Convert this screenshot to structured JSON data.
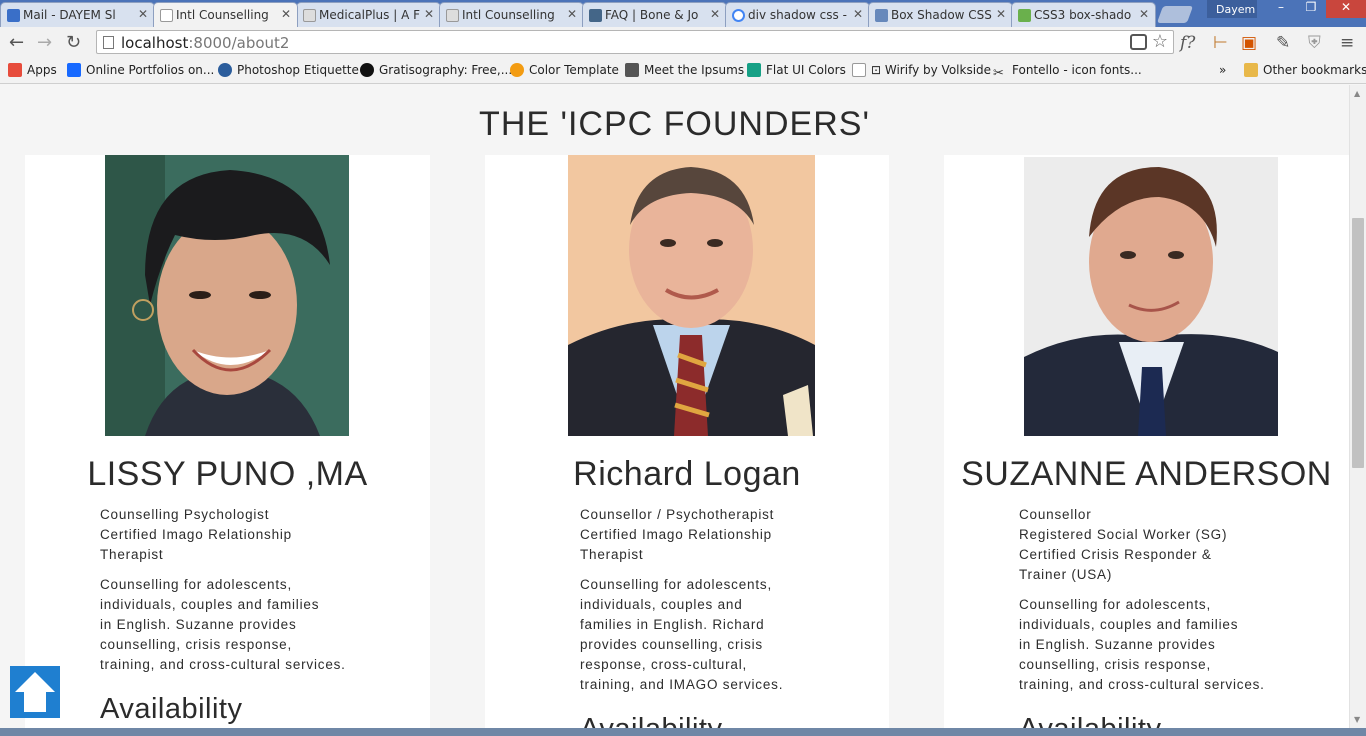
{
  "browser": {
    "tabs": [
      {
        "title": "Mail - DAYEM Sl",
        "favicon_color": "#3a6fc8",
        "active": false
      },
      {
        "title": "Intl Counselling",
        "favicon_color": "#eeeeee",
        "active": true
      },
      {
        "title": "MedicalPlus | A F",
        "favicon_color": "#dddddd",
        "active": false
      },
      {
        "title": "Intl Counselling",
        "favicon_color": "#dddddd",
        "active": false
      },
      {
        "title": "FAQ | Bone & Jo",
        "favicon_color": "#446688",
        "active": false
      },
      {
        "title": "div shadow css -",
        "favicon_color": "#4285f4",
        "active": false
      },
      {
        "title": "Box Shadow CSS",
        "favicon_color": "#6688bb",
        "active": false
      },
      {
        "title": "CSS3 box-shado",
        "favicon_color": "#6ab04c",
        "active": false
      }
    ],
    "user": "Dayem",
    "window_controls": {
      "minimize": "–",
      "maximize": "❐",
      "close": "✕"
    },
    "url_host": "localhost",
    "url_path": ":8000/about2",
    "bookmarks": [
      {
        "label": "Apps",
        "icon": "apps-grid-icon",
        "color": "#e74c3c"
      },
      {
        "label": "Online Portfolios on...",
        "icon": "behance-icon",
        "color": "#1769ff"
      },
      {
        "label": "Photoshop Etiquette",
        "icon": "photoshop-icon",
        "color": "#2b5d9c"
      },
      {
        "label": "Gratisography: Free,...",
        "icon": "gratisography-icon",
        "color": "#111111"
      },
      {
        "label": "Color Template",
        "icon": "color-wheel-icon",
        "color": "#f39c12"
      },
      {
        "label": "Meet the Ipsums",
        "icon": "ipsum-icon",
        "color": "#555555"
      },
      {
        "label": "Flat UI Colors",
        "icon": "flat-ui-icon",
        "color": "#16a085"
      },
      {
        "label": "⊡ Wirify by Volkside",
        "icon": "page-icon",
        "color": "#bbbbbb"
      },
      {
        "label": "Fontello - icon fonts...",
        "icon": "scissors-icon",
        "color": "#333333"
      }
    ],
    "bookmarks_more": "»",
    "other_bookmarks": "Other bookmarks"
  },
  "page": {
    "heading": "THE 'ICPC FOUNDERS'",
    "founders": [
      {
        "name": "LISSY PUNO ,MA",
        "roles": [
          "Counselling Psychologist",
          "Certified Imago Relationship",
          "Therapist"
        ],
        "description": [
          "Counselling for adolescents,",
          "individuals, couples and families",
          "in English. Suzanne provides",
          "counselling, crisis response,",
          "training, and cross-cultural services."
        ],
        "availability": "Availability",
        "photo_bg": "#2c5a4e"
      },
      {
        "name": "Richard Logan",
        "roles": [
          "Counsellor / Psychotherapist",
          "Certified Imago Relationship",
          "Therapist"
        ],
        "description": [
          "Counselling for adolescents,",
          "individuals, couples and",
          "families in English. Richard",
          "provides counselling, crisis",
          "response, cross-cultural,",
          "training, and IMAGO services."
        ],
        "availability": "Availability",
        "photo_bg": "#f2c7a0"
      },
      {
        "name": "SUZANNE ANDERSON",
        "roles": [
          "Counsellor",
          "Registered Social Worker (SG)",
          "Certified Crisis Responder &",
          "Trainer (USA)"
        ],
        "description": [
          "Counselling for adolescents,",
          "individuals, couples and families",
          "in English. Suzanne provides",
          "counselling, crisis response,",
          "training, and cross-cultural services."
        ],
        "availability": "Availability",
        "photo_bg": "#e8e8e8"
      }
    ]
  }
}
